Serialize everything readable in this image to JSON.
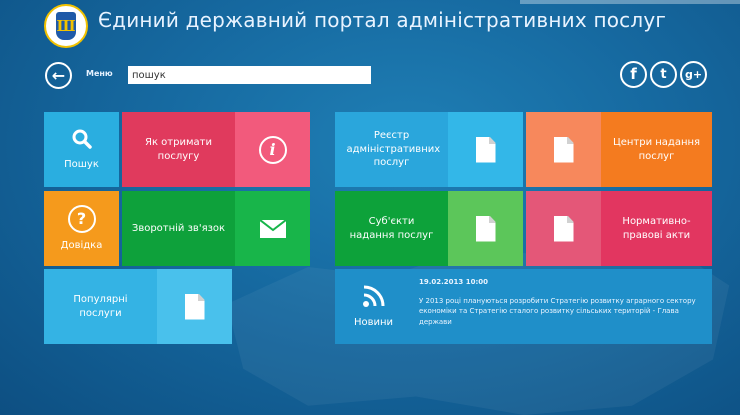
{
  "header": {
    "portal_title": "Єдиний державний портал адміністративних послуг",
    "logo_symbol": "Ш"
  },
  "toolbar": {
    "menu_label": "Меню",
    "search_value": "пошук",
    "back_icon": "arrow-left-icon"
  },
  "social": [
    {
      "name": "facebook",
      "glyph": "f"
    },
    {
      "name": "twitter",
      "glyph": "t"
    },
    {
      "name": "google-plus",
      "glyph": "g+"
    }
  ],
  "tiles": {
    "search": {
      "label": "Пошук",
      "color": "#2aaee0",
      "icon": "magnifier-icon"
    },
    "how_to": {
      "label": "Як отримати послугу",
      "color": "#e03a5d"
    },
    "info": {
      "icon_text": "i",
      "color": "#f25a7c"
    },
    "help": {
      "label": "Довідка",
      "color": "#f59a1c",
      "icon_text": "?"
    },
    "feedback": {
      "label": "Зворотній зв'язок",
      "color": "#0ea13b"
    },
    "mail": {
      "color": "#18b54a",
      "icon": "envelope-icon"
    },
    "popular": {
      "label": "Популярні послуги",
      "color": "#34b3e4"
    },
    "popular_icon": {
      "color": "#49c1ec"
    },
    "registry": {
      "label": "Реєстр адміністративних послуг",
      "color": "#2aa6dc"
    },
    "registry_icon": {
      "color": "#33b7e8"
    },
    "centers_icon": {
      "color": "#f7885c"
    },
    "centers": {
      "label": "Центри надання послуг",
      "color": "#f47b1f"
    },
    "subjects": {
      "label": "Суб'єкти надання послуг",
      "color": "#0da23a"
    },
    "subjects_icon": {
      "color": "#5cc65a"
    },
    "norms_icon": {
      "color": "#e45778"
    },
    "norms": {
      "label": "Нормативно-правові акти",
      "color": "#e23660"
    },
    "news": {
      "label": "Новини",
      "color": "#1f8fc9",
      "date": "19.02.2013 10:00",
      "text": "У 2013 році плануються розробити Стратегію розвитку аграрного сектору економіки та Стратегію сталого розвитку сільських територій - Глава держави"
    }
  }
}
